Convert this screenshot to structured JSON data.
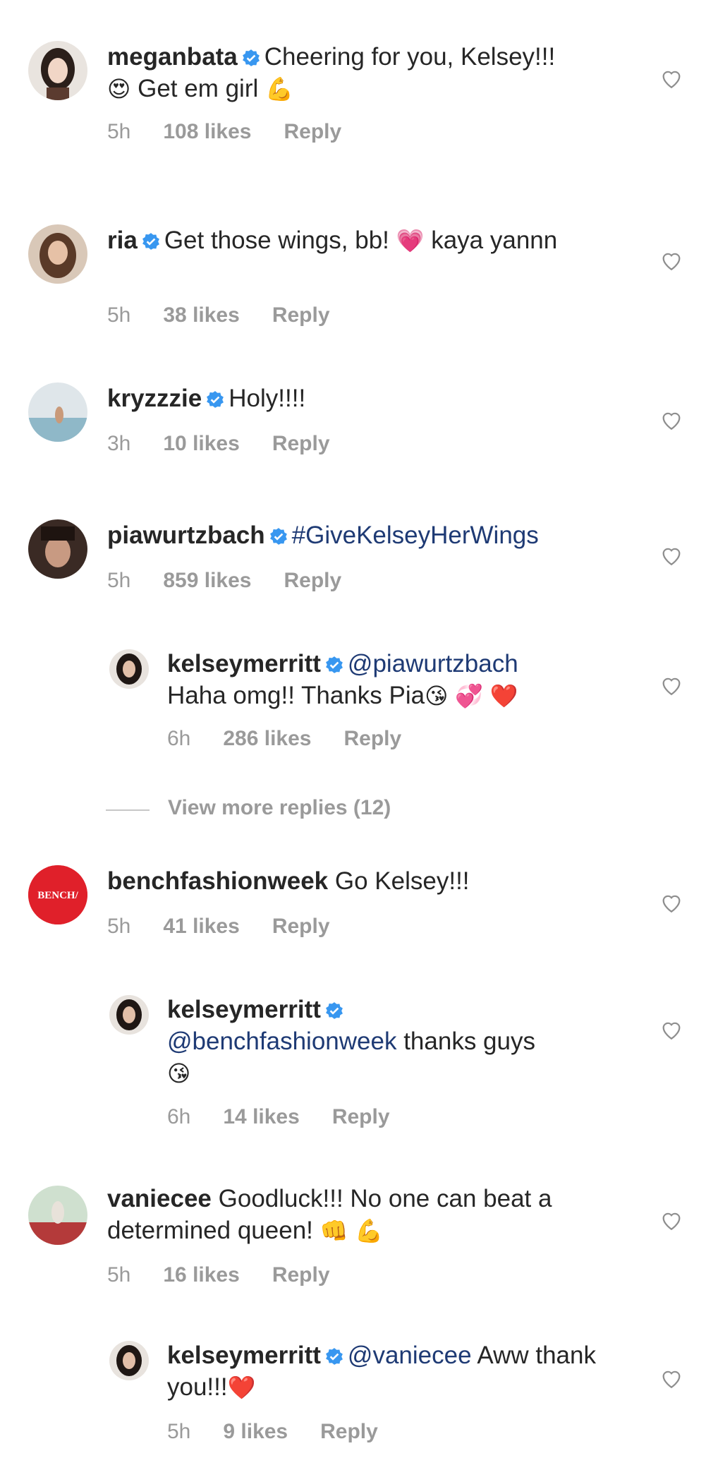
{
  "comments": [
    {
      "username": "meganbata",
      "text": "Cheering for you, Kelsey!!!",
      "emoji1": "😍",
      "text2": "Get em girl",
      "emoji2": "💪",
      "time": "5h",
      "likes": "108 likes",
      "reply": "Reply"
    },
    {
      "username": "ria",
      "text": "Get those wings, bb!",
      "emoji1": "💗",
      "text2": "kaya yannn",
      "time": "5h",
      "likes": "38 likes",
      "reply": "Reply"
    },
    {
      "username": "kryzzzie",
      "text": "Holy!!!!",
      "time": "3h",
      "likes": "10 likes",
      "reply": "Reply"
    },
    {
      "username": "piawurtzbach",
      "text": "#GiveKelseyHerWings",
      "time": "5h",
      "likes": "859 likes",
      "reply": "Reply"
    },
    {
      "username": "kelseymerritt",
      "mention": "@piawurtzbach",
      "text": "Haha omg!! Thanks Pia",
      "emoji1": "😘",
      "emoji2": "💞",
      "emoji3": "❤️",
      "time": "6h",
      "likes": "286 likes",
      "reply": "Reply"
    },
    {
      "username": "benchfashionweek",
      "text": "Go Kelsey!!!",
      "avatar_text": "BENCH/",
      "time": "5h",
      "likes": "41 likes",
      "reply": "Reply"
    },
    {
      "username": "kelseymerritt",
      "mention": "@benchfashionweek",
      "text": "thanks guys",
      "emoji1": "😘",
      "time": "6h",
      "likes": "14 likes",
      "reply": "Reply"
    },
    {
      "username": "vaniecee",
      "text": "Goodluck!!! No one can beat a determined queen!",
      "emoji1": "👊",
      "emoji2": "💪",
      "time": "5h",
      "likes": "16 likes",
      "reply": "Reply"
    },
    {
      "username": "kelseymerritt",
      "mention": "@vaniecee",
      "text": "Aww thank you!!!",
      "emoji1": "❤️",
      "time": "5h",
      "likes": "9 likes",
      "reply": "Reply"
    }
  ],
  "view_more": "View more replies (12)",
  "icons": {
    "verified": "verified-badge-icon",
    "heart": "heart-outline-icon"
  },
  "colors": {
    "verified": "#3897f0",
    "mention": "#1e3a74",
    "meta": "#9a9a9a",
    "bench": "#e0202a"
  }
}
